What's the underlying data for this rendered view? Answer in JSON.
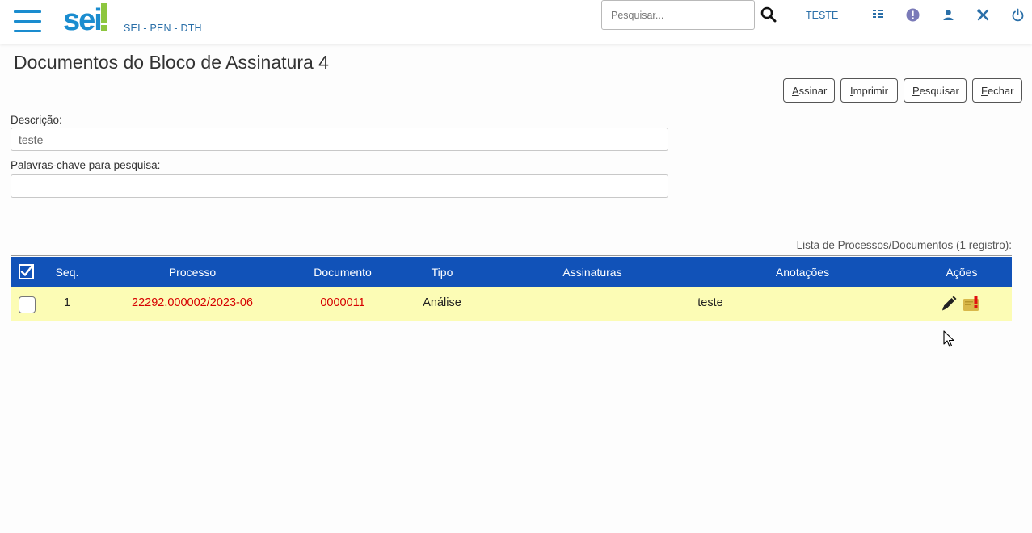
{
  "header": {
    "logo_text": "sei!",
    "unit": "SEI - PEN - DTH",
    "search_placeholder": "Pesquisar...",
    "user": "TESTE"
  },
  "page": {
    "title": "Documentos do Bloco de Assinatura 4"
  },
  "toolbar": {
    "assinar_first": "A",
    "assinar_rest": "ssinar",
    "imprimir_first": "I",
    "imprimir_rest": "mprimir",
    "pesquisar_first": "P",
    "pesquisar_rest": "esquisar",
    "fechar_first": "F",
    "fechar_rest": "echar"
  },
  "form": {
    "descricao_label": "Descrição:",
    "descricao_value": "teste",
    "palavras_label": "Palavras-chave para pesquisa:",
    "palavras_value": ""
  },
  "table": {
    "caption": "Lista de Processos/Documentos (1 registro):",
    "headers": {
      "seq": "Seq.",
      "processo": "Processo",
      "documento": "Documento",
      "tipo": "Tipo",
      "assinaturas": "Assinaturas",
      "anotacoes": "Anotações",
      "acoes": "Ações"
    },
    "rows": [
      {
        "seq": "1",
        "processo": "22292.000002/2023-06",
        "documento": "0000011",
        "tipo": "Análise",
        "assinaturas": "",
        "anotacoes": "teste",
        "checked": false
      }
    ]
  },
  "colors": {
    "header_blue": "#1152b8",
    "row_highlight": "#fcfcb5",
    "link_red": "#d60000",
    "brand_blue": "#1a8ccf",
    "brand_green": "#8dc63f"
  },
  "icons": [
    "menu-icon",
    "search-icon",
    "panel-icon",
    "alert-icon",
    "user-icon",
    "tools-icon",
    "power-icon",
    "pencil-icon",
    "annotation-icon"
  ]
}
